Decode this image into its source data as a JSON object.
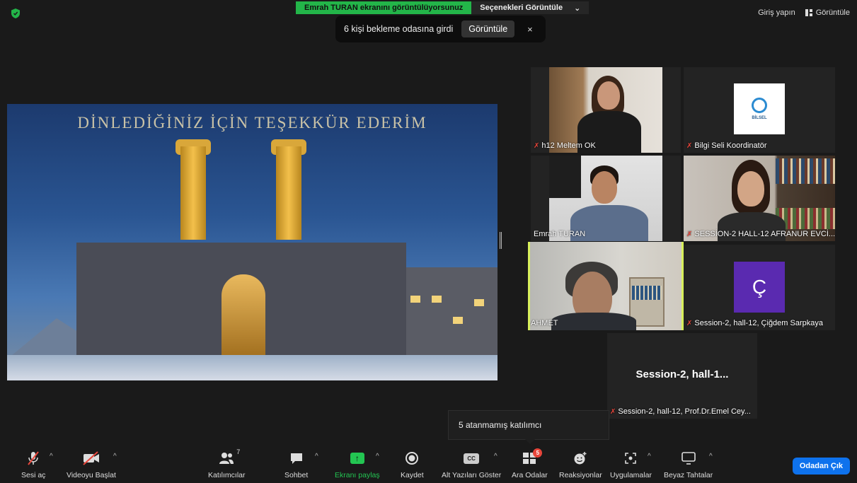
{
  "banner": {
    "sharing_text": "Emrah TURAN ekranını görüntülüyorsunuz",
    "options_label": "Seçenekleri Görüntüle"
  },
  "notice": {
    "text": "6 kişi bekleme odasına girdi",
    "view_label": "Görüntüle",
    "close_glyph": "×"
  },
  "top_right": {
    "signin_label": "Giriş yapın",
    "view_label": "Görüntüle"
  },
  "slide": {
    "title": "DİNLEDİĞİNİZ İÇİN TEŞEKKÜR EDERİM"
  },
  "participants": [
    {
      "name": "h12 Meltem OK",
      "muted": true
    },
    {
      "name": "Bilgi Seli Koordinatör",
      "muted": true,
      "logo_text": "BİLSEL"
    },
    {
      "name": "Emrah TURAN",
      "muted": false
    },
    {
      "name": "SESSİON-2 HALL-12 AFRANUR EVCİ...",
      "muted": true
    },
    {
      "name": "AHMET",
      "muted": false,
      "active": true
    },
    {
      "name": "Session-2, hall-12, Çiğdem Sarpkaya",
      "muted": true,
      "avatar_letter": "Ç"
    },
    {
      "name": "Session-2, hall-12, Prof.Dr.Emel Cey...",
      "muted": true,
      "display_name": "Session-2, hall-1..."
    }
  ],
  "tooltip": {
    "text": "5 atanmamış katılımcı"
  },
  "toolbar": {
    "unmute": "Sesi aç",
    "start_video": "Videoyu Başlat",
    "participants": "Katılımcılar",
    "participants_count": "7",
    "chat": "Sohbet",
    "share": "Ekranı paylaş",
    "record": "Kaydet",
    "captions": "Alt Yazıları Göster",
    "cc": "CC",
    "breakout": "Ara Odalar",
    "breakout_badge": "5",
    "reactions": "Reaksiyonlar",
    "apps": "Uygulamalar",
    "whiteboard": "Beyaz Tahtalar",
    "leave": "Odadan Çık"
  },
  "colors": {
    "accent_green": "#23b549",
    "active_outline": "#d8f05b",
    "leave_blue": "#0e72ed",
    "avatar_purple": "#5a2ab0",
    "mute_red": "#e8463b"
  }
}
